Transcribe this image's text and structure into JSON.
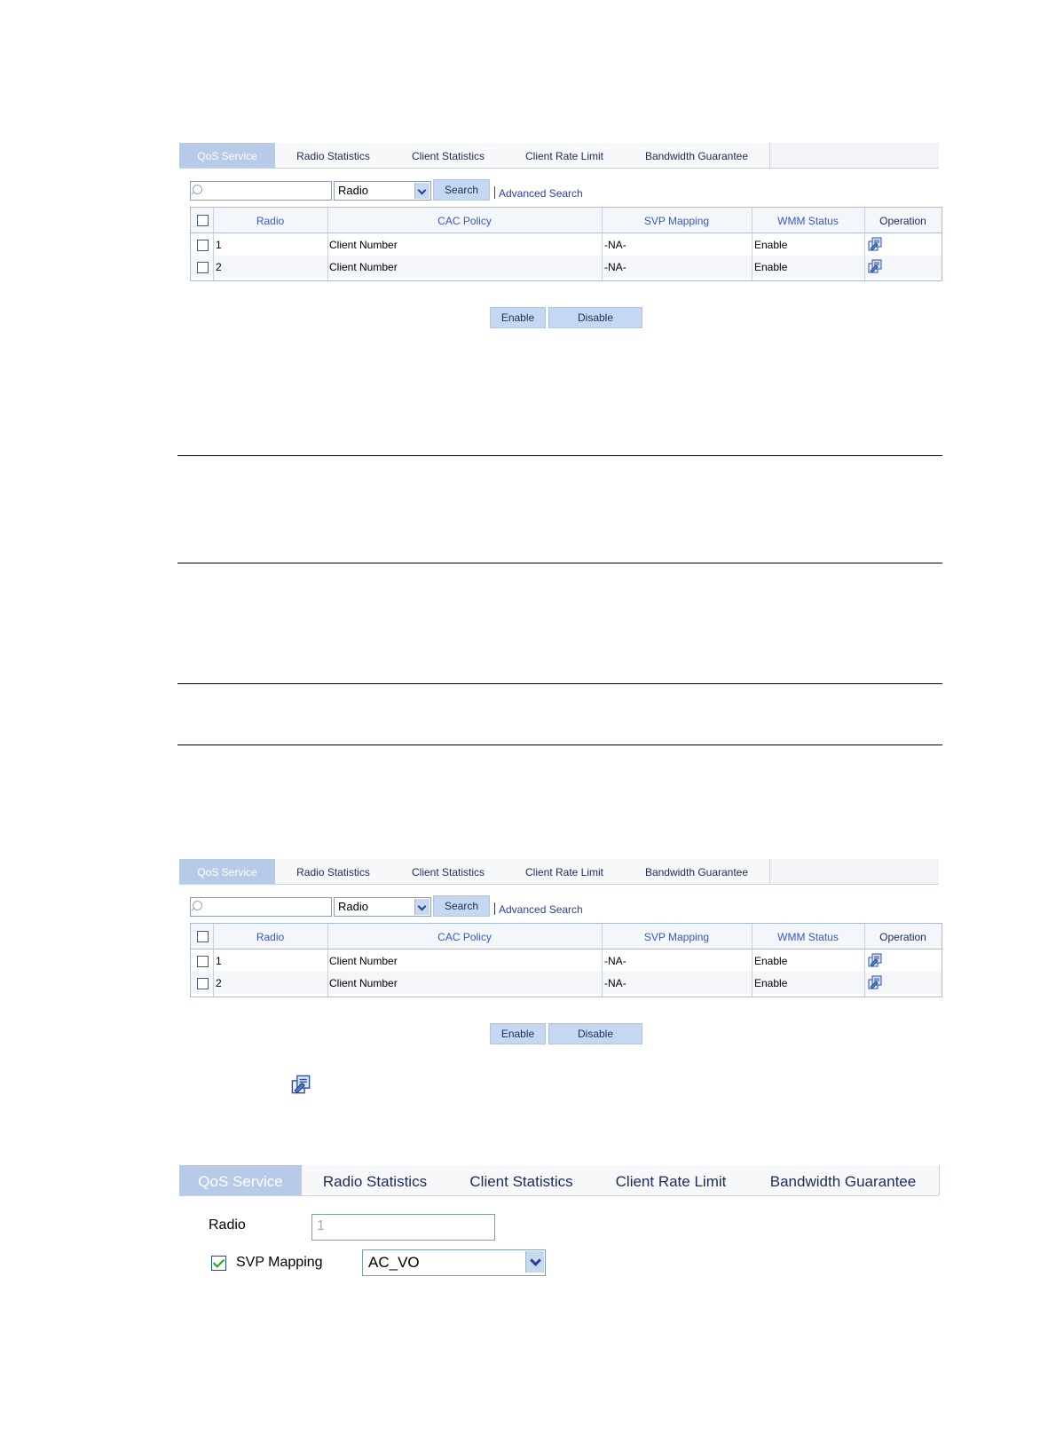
{
  "tabs": [
    "QoS Service",
    "Radio Statistics",
    "Client Statistics",
    "Client Rate Limit",
    "Bandwidth Guarantee"
  ],
  "search": {
    "input_value": "",
    "select_value": "Radio",
    "search_button": "Search",
    "advanced_link": "Advanced Search"
  },
  "table": {
    "headers": [
      "Radio",
      "CAC Policy",
      "SVP Mapping",
      "WMM Status",
      "Operation"
    ],
    "rows": [
      {
        "radio": "1",
        "cac_policy": "Client Number",
        "svp_mapping": "-NA-",
        "wmm_status": "Enable",
        "operation_icon": "edit-icon"
      },
      {
        "radio": "2",
        "cac_policy": "Client Number",
        "svp_mapping": "-NA-",
        "wmm_status": "Enable",
        "operation_icon": "edit-icon"
      }
    ]
  },
  "buttons": {
    "enable": "Enable",
    "disable": "Disable"
  },
  "form": {
    "radio_label": "Radio",
    "radio_value": "1",
    "svp_label": "SVP Mapping",
    "svp_checked": true,
    "svp_value": "AC_VO"
  },
  "colors": {
    "active_tab": "#b7cbe9",
    "button_bg": "#c6d8f1",
    "link": "#2a3ea8",
    "header_text": "#3a56c4"
  }
}
